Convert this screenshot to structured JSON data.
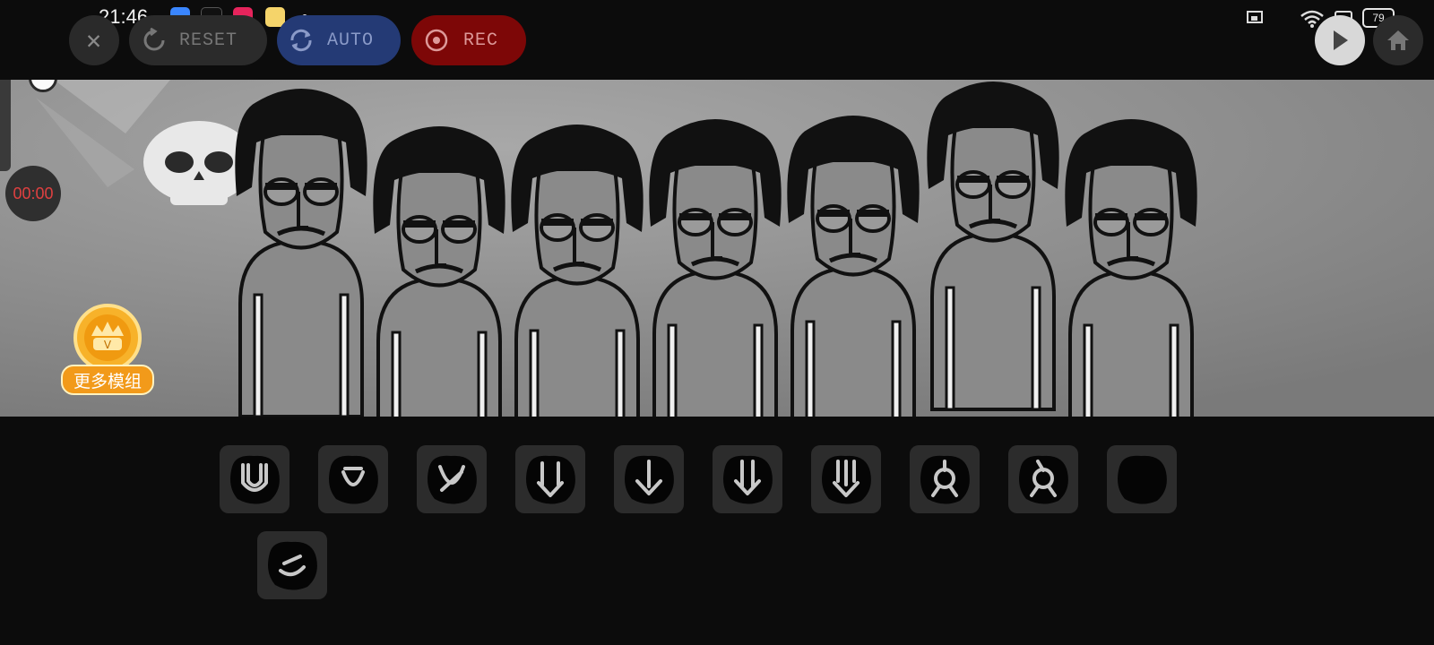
{
  "status_bar": {
    "time": "21:46",
    "battery": "79"
  },
  "toolbar": {
    "close_label": "✕",
    "reset_label": "RESET",
    "auto_label": "AUTO",
    "rec_label": "REC"
  },
  "timer": "00:00",
  "mods_badge": {
    "label": "更多模组",
    "icon": "crown-v-coin-icon"
  },
  "sound_icons": [
    {
      "icon": "u-shape-icon"
    },
    {
      "icon": "u-shape-small-icon"
    },
    {
      "icon": "u-shape-crossed-icon"
    },
    {
      "icon": "double-arrow-down-icon"
    },
    {
      "icon": "arrow-down-icon"
    },
    {
      "icon": "arrow-down-flag-icon"
    },
    {
      "icon": "triple-arrow-down-icon"
    },
    {
      "icon": "circle-legs-icon"
    },
    {
      "icon": "circle-legs-dark-icon"
    },
    {
      "icon": "blob-icon"
    },
    {
      "icon": "bird-head-icon"
    }
  ],
  "colors": {
    "auto": "#243a75",
    "rec": "#7d0707",
    "stage": "#8c8c8c",
    "mods_badge": "#f29a1a"
  }
}
